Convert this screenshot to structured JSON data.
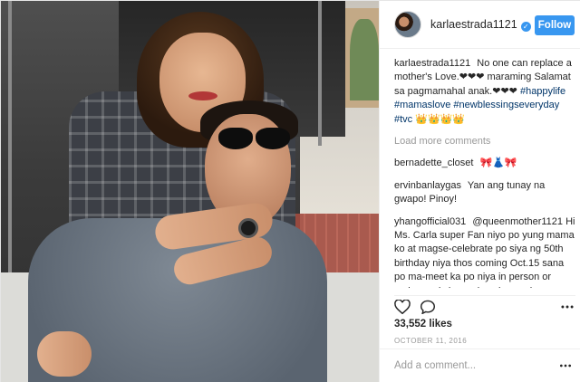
{
  "post": {
    "username": "karlaestrada1121",
    "follow_label": "Follow",
    "verified_icon": "verified-badge-icon",
    "caption": {
      "username": "karlaestrada1121",
      "text": "No one can replace a mother's Love.❤❤❤ maraming Salamat sa pagmamahal anak.❤❤❤",
      "hashtags": "#happylife #mamaslove #newblessingseveryday #tvc",
      "emoji": "👑👑👑👑"
    },
    "load_more": "Load more comments",
    "comments": [
      {
        "username": "bernadette_closet",
        "text": "🎀👗🎀"
      },
      {
        "username": "ervinbanlaygas",
        "text": "Yan ang tunay na gwapo! Pinoy!"
      },
      {
        "username": "yhangofficial031",
        "text": "@queenmother1121 Hi Ms. Carla super Fan niyo po yung mama ko at magse-celebrate po siya ng 50th birthday niya thos coming Oct.15 sana po ma-meet ka po niya in person or makanuod siya sa isa niyong show ng live .. Actually kababata niyo dw po siya sa tacloban ewan ko po kung totoo pero sya dw po yung reason ng peklat niyo sa sa kilay dahil sa Tumbang preso medyo korny"
      }
    ],
    "likes": "33,552 likes",
    "date": "OCTOBER 11, 2016",
    "add_comment_placeholder": "Add a comment...",
    "accent_color": "#3897f0"
  }
}
